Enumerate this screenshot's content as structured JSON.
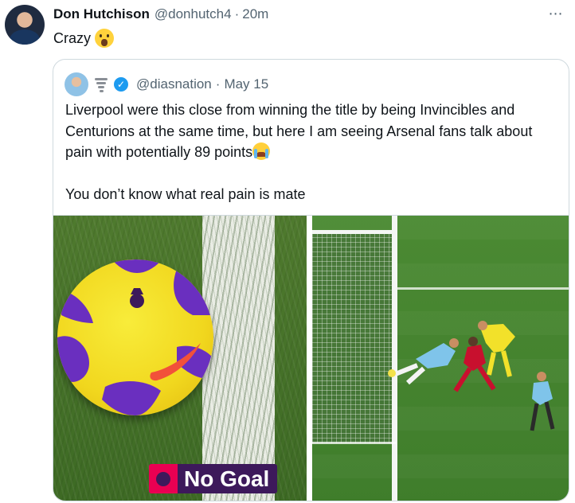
{
  "tweet": {
    "author_name": "Don Hutchison",
    "author_handle": "@donhutch4",
    "separator": "·",
    "time": "20m",
    "text": "Crazy",
    "more_icon": "⋯"
  },
  "quoted": {
    "handle": "@diasnation",
    "separator": "·",
    "date": "May 15",
    "verified_icon": "✓",
    "lines": [
      "Liverpool were this close from winning the title by being Invincibles  and",
      "Centurions at the same time, but here I am seeing Arsenal fans talk about",
      "pain with potentially 89 points"
    ],
    "second_paragraph": "You don’t know what real pain is mate",
    "media": {
      "left_overlay_text": "No Goal"
    }
  },
  "colors": {
    "accent": "#1d9bf0",
    "pl_purple": "#3d195b",
    "pl_pink": "#e90052",
    "ball_purple": "#6a2fbf",
    "nike_swoosh": "#f2513a"
  }
}
